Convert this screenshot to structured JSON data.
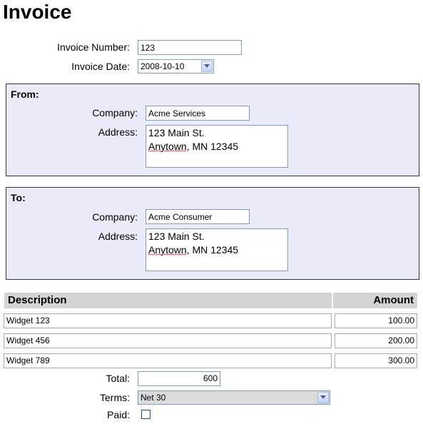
{
  "title": "Invoice",
  "invoice": {
    "number_label": "Invoice Number:",
    "number_value": "123",
    "date_label": "Invoice Date:",
    "date_value": "2008-10-10"
  },
  "from": {
    "title": "From:",
    "company_label": "Company:",
    "company_value": "Acme Services",
    "address_label": "Address:",
    "address_line1": "123 Main St.",
    "address_line2_city": "Anytown",
    "address_line2_rest": ", MN 12345"
  },
  "to": {
    "title": "To:",
    "company_label": "Company:",
    "company_value": "Acme Consumer",
    "address_label": "Address:",
    "address_line1": "123 Main St.",
    "address_line2_city": "Anytown",
    "address_line2_rest": ", MN 12345"
  },
  "items": {
    "headers": {
      "description": "Description",
      "amount": "Amount"
    },
    "rows": [
      {
        "description": "Widget 123",
        "amount": "100.00"
      },
      {
        "description": "Widget 456",
        "amount": "200.00"
      },
      {
        "description": "Widget 789",
        "amount": "300.00"
      }
    ]
  },
  "totals": {
    "total_label": "Total:",
    "total_value": "600",
    "terms_label": "Terms:",
    "terms_value": "Net 30",
    "paid_label": "Paid:",
    "paid_checked": false
  },
  "icons": {
    "dropdown": "chevron-down-icon"
  }
}
